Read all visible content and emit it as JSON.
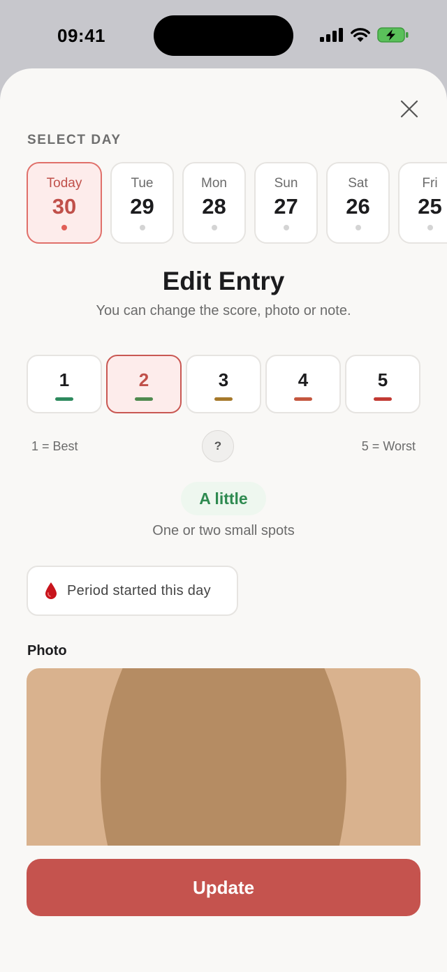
{
  "status_bar": {
    "time": "09:41"
  },
  "header": {
    "select_day_label": "SELECT DAY"
  },
  "days": [
    {
      "name": "Today",
      "number": "30",
      "selected": true
    },
    {
      "name": "Tue",
      "number": "29"
    },
    {
      "name": "Mon",
      "number": "28"
    },
    {
      "name": "Sun",
      "number": "27"
    },
    {
      "name": "Sat",
      "number": "26"
    },
    {
      "name": "Fri",
      "number": "25"
    }
  ],
  "entry": {
    "title": "Edit Entry",
    "subtitle": "You can change the score, photo or note."
  },
  "scores": [
    {
      "value": "1",
      "color": "#2e8a5e"
    },
    {
      "value": "2",
      "color": "#4f8a4f",
      "selected": true
    },
    {
      "value": "3",
      "color": "#a6792b"
    },
    {
      "value": "4",
      "color": "#c4573f"
    },
    {
      "value": "5",
      "color": "#c23a33"
    }
  ],
  "scale": {
    "best": "1 = Best",
    "worst": "5 = Worst",
    "help": "?"
  },
  "severity": {
    "label": "A little",
    "description": "One or two small spots",
    "color": "#2e8a50"
  },
  "period": {
    "label": "Period started this day",
    "icon": "blood-drop-icon"
  },
  "photo": {
    "label": "Photo"
  },
  "actions": {
    "update_label": "Update"
  },
  "colors": {
    "accent": "#c5534e",
    "background": "#f9f8f6"
  }
}
